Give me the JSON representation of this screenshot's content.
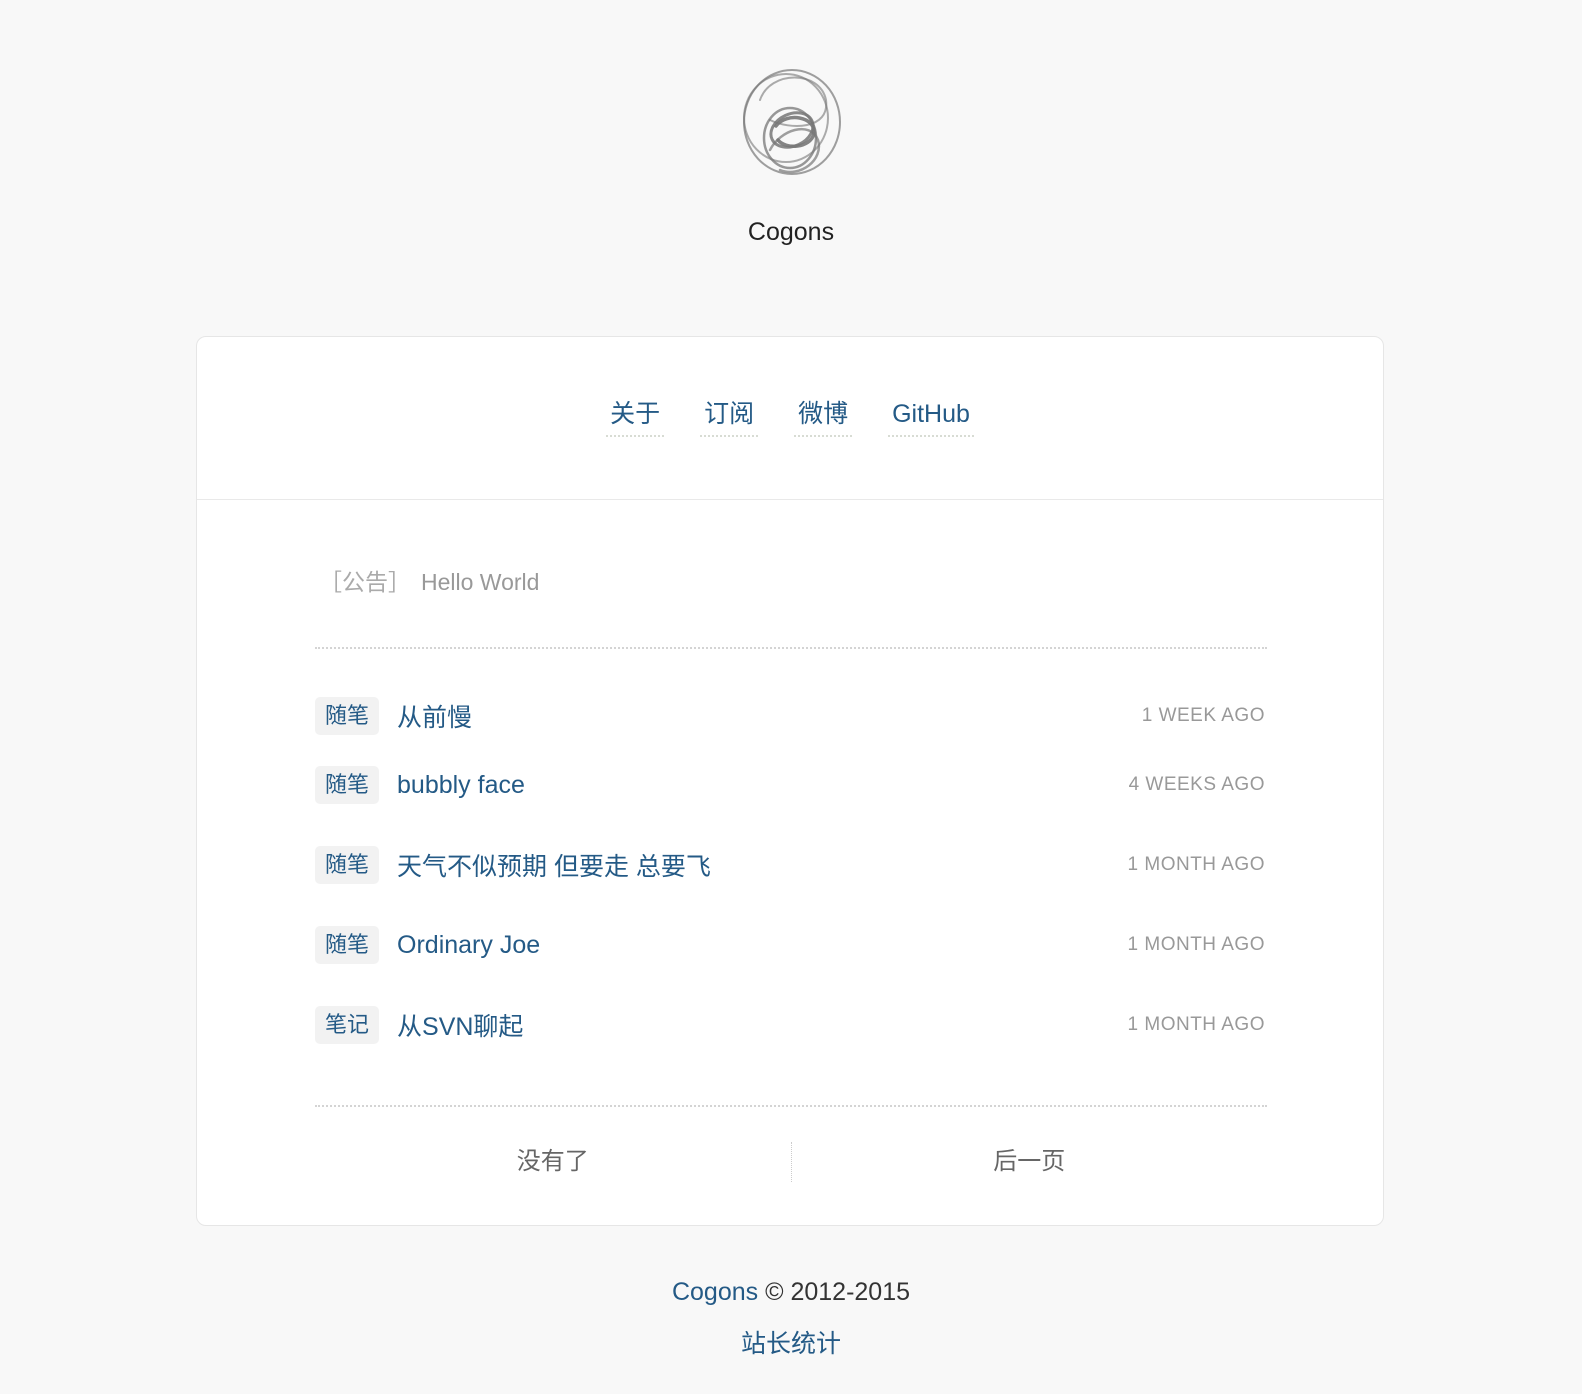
{
  "site": {
    "title": "Cogons",
    "logo_icon": "scribble-circle-logo-icon"
  },
  "nav": {
    "items": [
      {
        "label": "关于"
      },
      {
        "label": "订阅"
      },
      {
        "label": "微博"
      },
      {
        "label": "GitHub"
      }
    ]
  },
  "notice": {
    "bracket_label": "［公告］",
    "text": "Hello World"
  },
  "posts": [
    {
      "tag": "随笔",
      "title": "从前慢",
      "date": "1 WEEK AGO"
    },
    {
      "tag": "随笔",
      "title": "bubbly face",
      "date": "4 WEEKS AGO"
    },
    {
      "tag": "随笔",
      "title": "天气不似预期 但要走 总要飞",
      "date": "1 MONTH AGO"
    },
    {
      "tag": "随笔",
      "title": "Ordinary Joe",
      "date": "1 MONTH AGO"
    },
    {
      "tag": "笔记",
      "title": "从SVN聊起",
      "date": "1 MONTH AGO"
    }
  ],
  "pager": {
    "prev_label": "没有了",
    "next_label": "后一页"
  },
  "footer": {
    "brand": "Cogons",
    "copyright": " © 2012-2015",
    "stats_label": "站长统计"
  },
  "colors": {
    "background": "#f8f8f8",
    "link": "#245a86",
    "muted": "#999999",
    "card": "#ffffff"
  }
}
